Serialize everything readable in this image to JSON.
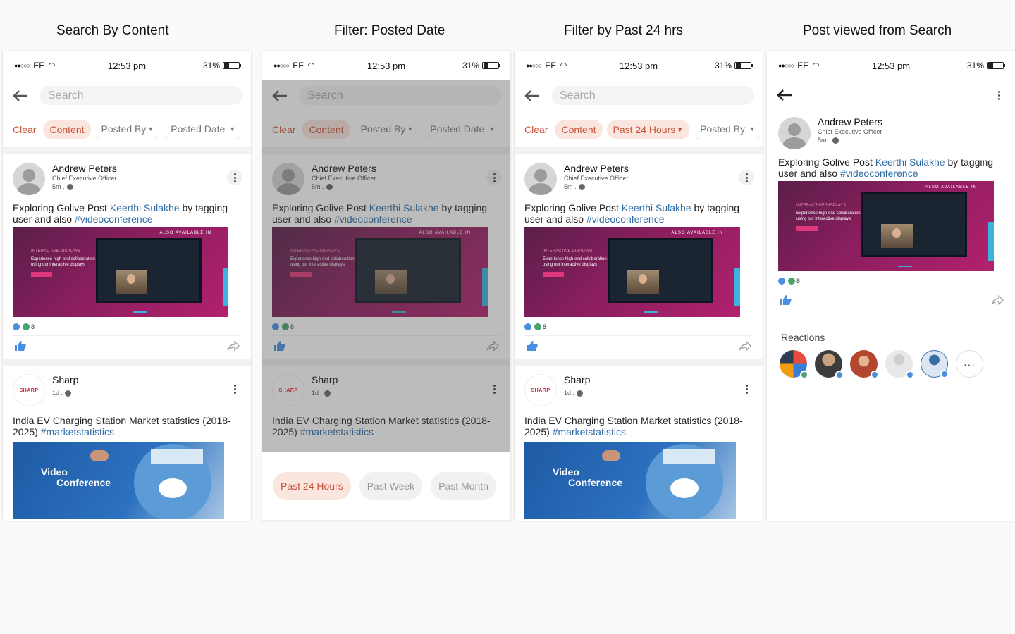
{
  "titles": [
    "Search By Content",
    "Filter: Posted Date",
    "Filter by Past 24 hrs",
    "Post viewed from Search"
  ],
  "status": {
    "carrier": "EE",
    "time": "12:53 pm",
    "battery": "31%"
  },
  "search_placeholder": "Search",
  "filters": {
    "clear": "Clear",
    "content": "Content",
    "posted_by": "Posted By",
    "posted_date": "Posted Date",
    "past_24": "Past 24 Hours"
  },
  "post1": {
    "author": "Andrew Peters",
    "role": "Chief Executive Officer",
    "time": "5m .",
    "text_prefix": "Exploring Golive Post ",
    "mention": "Keerthi Sulakhe",
    "text_mid": " by tagging user and also ",
    "hashtag": "#videoconference",
    "banner_top": "ALSO AVAILABLE IN",
    "banner_tag": "INTERACTIVE DISPLAYS",
    "banner_text": "Experience high-end collaboration using our interactive displays",
    "reaction_count": "8"
  },
  "post2": {
    "author": "Sharp",
    "logo": "SHARP",
    "time": "1d .",
    "text": "India EV Charging Station Market statistics (2018-2025) ",
    "hashtag": "#marketstatistics",
    "image_line1": "Video",
    "image_line2": "Conference"
  },
  "sheet": {
    "past_24": "Past 24 Hours",
    "past_week": "Past Week",
    "past_month": "Past Month"
  },
  "detail": {
    "reactions_label": "Reactions",
    "more": "···"
  },
  "colors": {
    "accent": "#c8533a",
    "accent_bg": "#fbe5df",
    "link": "#2e6ca8",
    "like": "#4a8fe0"
  }
}
